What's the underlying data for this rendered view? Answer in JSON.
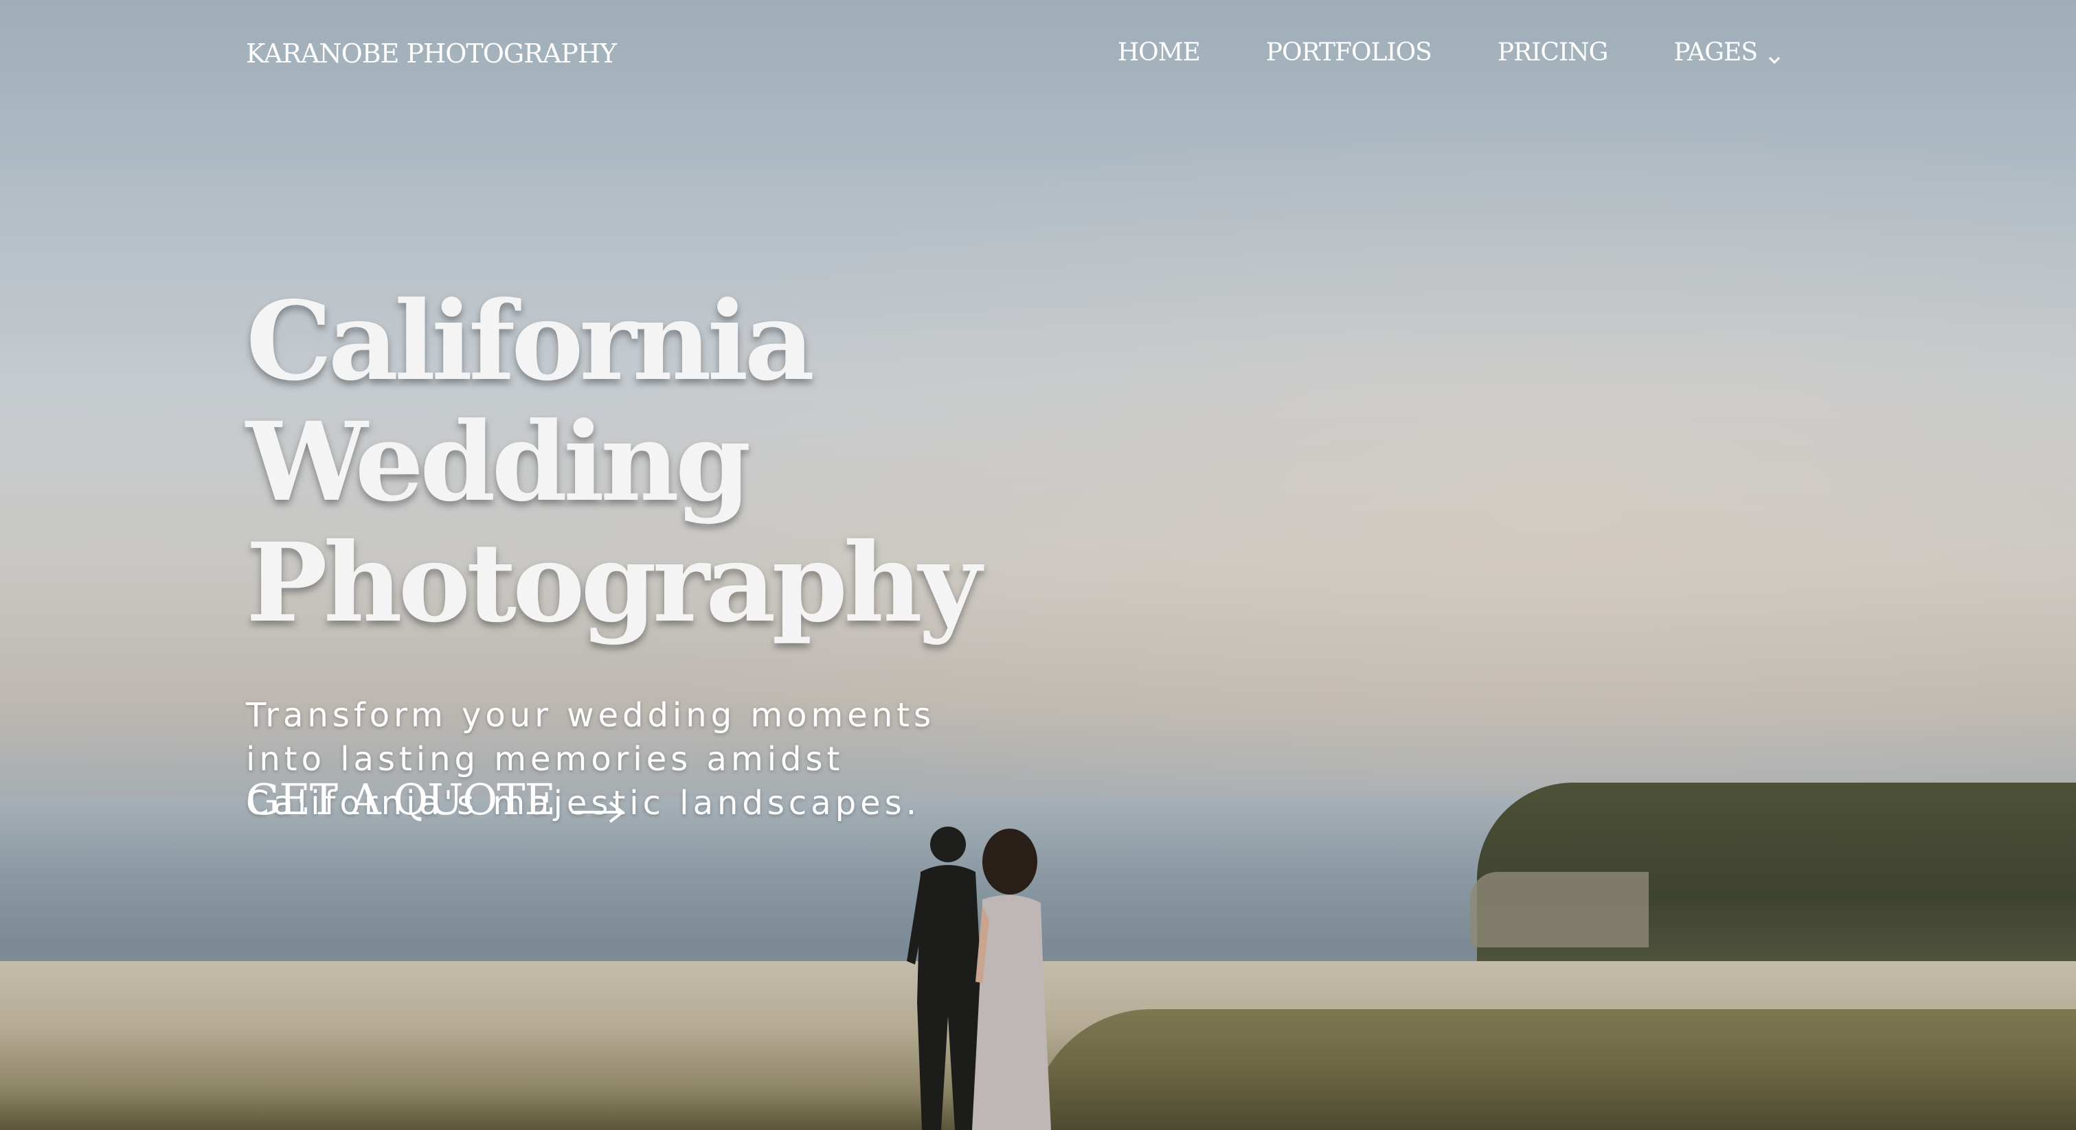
{
  "header": {
    "brand": "KARANOBE PHOTOGRAPHY",
    "nav": [
      {
        "label": "HOME"
      },
      {
        "label": "PORTFOLIOS"
      },
      {
        "label": "PRICING"
      },
      {
        "label": "PAGES",
        "icon": "chevron-down-icon"
      }
    ]
  },
  "hero": {
    "headline_line1": "California Wedding",
    "headline_line2": "Photography",
    "subtitle": "Transform your wedding moments into lasting memories amidst California's majestic landscapes.",
    "cta_label": "GET A QUOTE",
    "cta_icon": "arrow-right-icon",
    "background_image": "couple-on-coastal-cliff-photo"
  },
  "colors": {
    "text": "#ffffff",
    "sky": "#b3bec6",
    "sea": "#8a98a2",
    "grass": "#6c6644"
  }
}
